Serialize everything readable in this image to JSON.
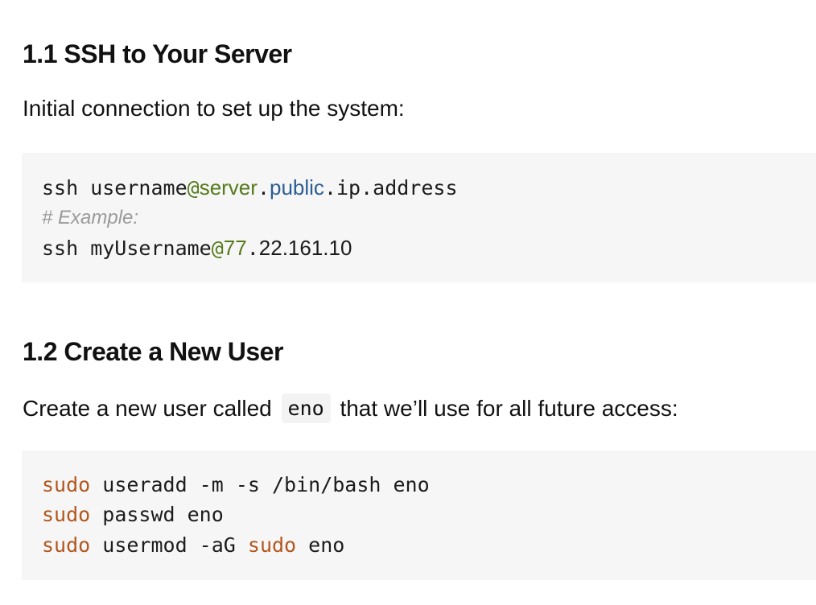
{
  "section1": {
    "heading": "1.1 SSH to Your Server",
    "intro": "Initial connection to set up the system:",
    "code": {
      "line1": {
        "cmd": "ssh",
        "user": " username",
        "at": "@",
        "host": "server",
        "dot1": ".",
        "kw": "public",
        "rest": ".ip.address"
      },
      "comment": "# Example:",
      "line3": {
        "cmd": "ssh",
        "user": " myUsername",
        "at": "@",
        "num": "77",
        "dot": ".",
        "ip_rest": "22.161.10"
      }
    }
  },
  "section2": {
    "heading": "1.2 Create a New User",
    "intro_before": "Create a new user called",
    "intro_code": "eno",
    "intro_after": "that we’ll use for all future access:",
    "code": [
      {
        "cmd": "sudo",
        "rest": " useradd -m -s /bin/bash eno"
      },
      {
        "cmd": "sudo",
        "rest": " passwd eno"
      },
      {
        "cmd": "sudo",
        "mid": " usermod -aG ",
        "cmd2": "sudo",
        "rest": " eno"
      }
    ]
  }
}
